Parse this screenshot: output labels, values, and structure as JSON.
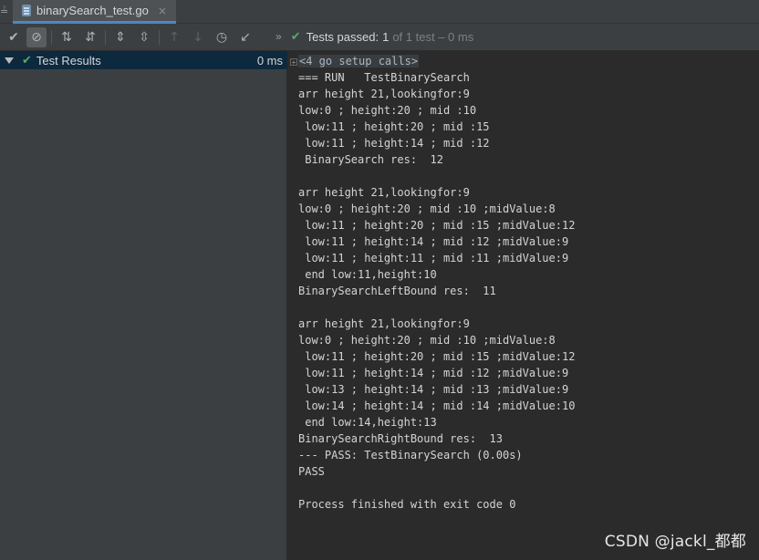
{
  "tabbar": {
    "edge_glyph": "≟",
    "tab": {
      "label": "binarySearch_test.go",
      "icon": "go-file-icon",
      "close_glyph": "×"
    }
  },
  "toolbar": {
    "buttons": [
      {
        "name": "show-passed",
        "icon": "check-icon",
        "glyph": "✔"
      },
      {
        "name": "show-ignored",
        "icon": "stop-icon",
        "glyph": "⊘"
      },
      {
        "name": "sort-alpha",
        "icon": "sort-alpha-icon",
        "glyph": "⇅"
      },
      {
        "name": "sort-duration",
        "icon": "sort-duration-icon",
        "glyph": "⇵"
      },
      {
        "name": "expand-all",
        "icon": "expand-all-icon",
        "glyph": "⇕"
      },
      {
        "name": "collapse-all",
        "icon": "collapse-all-icon",
        "glyph": "⇳"
      },
      {
        "name": "prev-failed",
        "icon": "arrow-up-icon",
        "glyph": "↑"
      },
      {
        "name": "next-failed",
        "icon": "arrow-down-icon",
        "glyph": "↓"
      },
      {
        "name": "test-history",
        "icon": "history-icon",
        "glyph": "◷"
      },
      {
        "name": "import-tests",
        "icon": "import-icon",
        "glyph": "↙"
      }
    ],
    "more_glyph": "»"
  },
  "status": {
    "check_glyph": "✔",
    "label": "Tests passed:",
    "passed": "1",
    "rest": "of 1 test – 0 ms"
  },
  "tree": {
    "root": {
      "label": "Test Results",
      "duration": "0 ms"
    }
  },
  "console": {
    "fold": {
      "marker": "+",
      "text": "<4 go setup calls>"
    },
    "lines": [
      "=== RUN   TestBinarySearch",
      "arr height 21,lookingfor:9",
      "low:0 ; height:20 ; mid :10",
      " low:11 ; height:20 ; mid :15",
      " low:11 ; height:14 ; mid :12",
      " BinarySearch res:  12",
      "",
      "arr height 21,lookingfor:9",
      "low:0 ; height:20 ; mid :10 ;midValue:8",
      " low:11 ; height:20 ; mid :15 ;midValue:12",
      " low:11 ; height:14 ; mid :12 ;midValue:9",
      " low:11 ; height:11 ; mid :11 ;midValue:9",
      " end low:11,height:10",
      "BinarySearchLeftBound res:  11",
      "",
      "arr height 21,lookingfor:9",
      "low:0 ; height:20 ; mid :10 ;midValue:8",
      " low:11 ; height:20 ; mid :15 ;midValue:12",
      " low:11 ; height:14 ; mid :12 ;midValue:9",
      " low:13 ; height:14 ; mid :13 ;midValue:9",
      " low:14 ; height:14 ; mid :14 ;midValue:10",
      " end low:14,height:13",
      "BinarySearchRightBound res:  13",
      "--- PASS: TestBinarySearch (0.00s)",
      "PASS",
      "",
      "Process finished with exit code 0"
    ]
  },
  "watermark": "CSDN @jackl_都都",
  "colors": {
    "pass_green": "#59a869",
    "selection": "#0d293e",
    "panel": "#3c3f41",
    "console_bg": "#2b2b2b",
    "tab_accent": "#4a88c7"
  }
}
